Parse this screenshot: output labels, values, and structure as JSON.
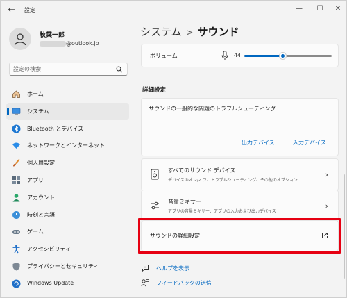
{
  "window": {
    "title": "設定",
    "back_icon": "back-arrow-icon",
    "minimize_icon": "minimize-icon",
    "maximize_icon": "maximize-icon",
    "close_icon": "close-icon"
  },
  "user": {
    "name": "秋葉一郎",
    "email_visible": "@outlook.jp",
    "avatar_icon": "person-icon"
  },
  "search": {
    "placeholder": "設定の検索",
    "icon": "search-icon"
  },
  "nav": {
    "items": [
      {
        "label": "ホーム",
        "icon": "home-icon",
        "active": false
      },
      {
        "label": "システム",
        "icon": "system-icon",
        "active": true
      },
      {
        "label": "Bluetooth とデバイス",
        "icon": "bluetooth-icon",
        "active": false
      },
      {
        "label": "ネットワークとインターネット",
        "icon": "wifi-icon",
        "active": false
      },
      {
        "label": "個人用設定",
        "icon": "brush-icon",
        "active": false
      },
      {
        "label": "アプリ",
        "icon": "apps-icon",
        "active": false
      },
      {
        "label": "アカウント",
        "icon": "account-icon",
        "active": false
      },
      {
        "label": "時刻と言語",
        "icon": "globe-clock-icon",
        "active": false
      },
      {
        "label": "ゲーム",
        "icon": "gamepad-icon",
        "active": false
      },
      {
        "label": "アクセシビリティ",
        "icon": "accessibility-icon",
        "active": false
      },
      {
        "label": "プライバシーとセキュリティ",
        "icon": "shield-icon",
        "active": false
      },
      {
        "label": "Windows Update",
        "icon": "update-icon",
        "active": false
      }
    ]
  },
  "breadcrumb": {
    "parent": "システム",
    "separator": ">",
    "current": "サウンド"
  },
  "volume": {
    "label": "ボリューム",
    "value": "44",
    "level": 44,
    "mic_icon": "microphone-icon"
  },
  "advanced": {
    "section_title": "詳細設定",
    "troubleshoot": {
      "title": "サウンドの一般的な問題のトラブルシューティング",
      "output_devices": "出力デバイス",
      "input_devices": "入力デバイス"
    },
    "all_devices": {
      "title": "すべてのサウンド デバイス",
      "subtitle": "デバイスのオン/オフ、トラブルシューティング、その他のオプション",
      "icon": "speaker-device-icon"
    },
    "mixer": {
      "title": "音量ミキサー",
      "subtitle": "アプリの音量ミキサー、アプリの入力および出力デバイス",
      "icon": "mixer-icon"
    },
    "more_settings": {
      "title": "サウンドの詳細設定",
      "icon": "external-link-icon"
    }
  },
  "help": {
    "get_help": "ヘルプを表示",
    "feedback": "フィードバックの送信"
  },
  "colors": {
    "accent": "#0067c0",
    "highlight": "#e60012"
  }
}
